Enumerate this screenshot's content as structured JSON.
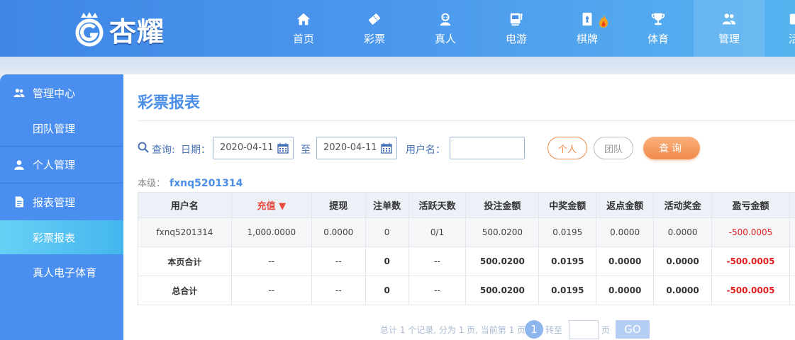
{
  "brand": {
    "name": "杏耀"
  },
  "nav": {
    "items": [
      {
        "label": "首页",
        "icon": "home-icon"
      },
      {
        "label": "彩票",
        "icon": "ticket-icon"
      },
      {
        "label": "真人",
        "icon": "dealer-icon"
      },
      {
        "label": "电游",
        "icon": "slot-machine-icon"
      },
      {
        "label": "棋牌",
        "icon": "cards-icon",
        "badge": "hot-flame-icon"
      },
      {
        "label": "体育",
        "icon": "trophy-icon"
      },
      {
        "label": "管理",
        "icon": "users-icon",
        "active": true
      },
      {
        "label": "活",
        "icon": "partial-icon"
      }
    ]
  },
  "sidebar": {
    "groups": [
      {
        "label": "管理中心",
        "icon": "users-icon",
        "children": [
          {
            "label": "团队管理"
          }
        ]
      },
      {
        "label": "个人管理",
        "icon": "user-icon",
        "children": []
      },
      {
        "label": "报表管理",
        "icon": "report-icon",
        "children": [
          {
            "label": "彩票报表",
            "active": true
          },
          {
            "label": "真人电子体育"
          }
        ]
      }
    ]
  },
  "main": {
    "title": "彩票报表",
    "filter": {
      "query_label": "查询:",
      "date_label": "日期：",
      "date_from": "2020-04-11",
      "date_to": "2020-04-11",
      "to_label": "至",
      "username_label": "用户名：",
      "username_value": "",
      "personal_label": "个人",
      "team_label": "团队",
      "query_button": "查询"
    },
    "level": {
      "label": "本级：",
      "username": "fxnq5201314"
    },
    "table": {
      "headers": [
        "用户名",
        "充值",
        "提现",
        "注单数",
        "活跃天数",
        "投注金额",
        "中奖金额",
        "返点金额",
        "活动奖金",
        "盈亏金额"
      ],
      "sort_column": "充值",
      "rows": [
        [
          "fxnq5201314",
          "1,000.0000",
          "0.0000",
          "0",
          "0/1",
          "500.0200",
          "0.0195",
          "0.0000",
          "0.0000",
          "-500.0005"
        ]
      ],
      "summary_rows": [
        [
          "本页合计",
          "--",
          "--",
          "0",
          "--",
          "500.0200",
          "0.0195",
          "0.0000",
          "0.0000",
          "-500.0005"
        ],
        [
          "总合计",
          "--",
          "--",
          "0",
          "--",
          "500.0200",
          "0.0195",
          "0.0000",
          "0.0000",
          "-500.0005"
        ]
      ]
    },
    "pager": {
      "summary": "总计 1 个记录, 分为 1 页, 当前第 1 页",
      "current_page": "1",
      "jump_label": "转至",
      "page_unit": "页",
      "go_label": "GO"
    }
  },
  "colors": {
    "accent": "#4a8ee8",
    "orange": "#f08a4b",
    "negative": "#e02020"
  }
}
